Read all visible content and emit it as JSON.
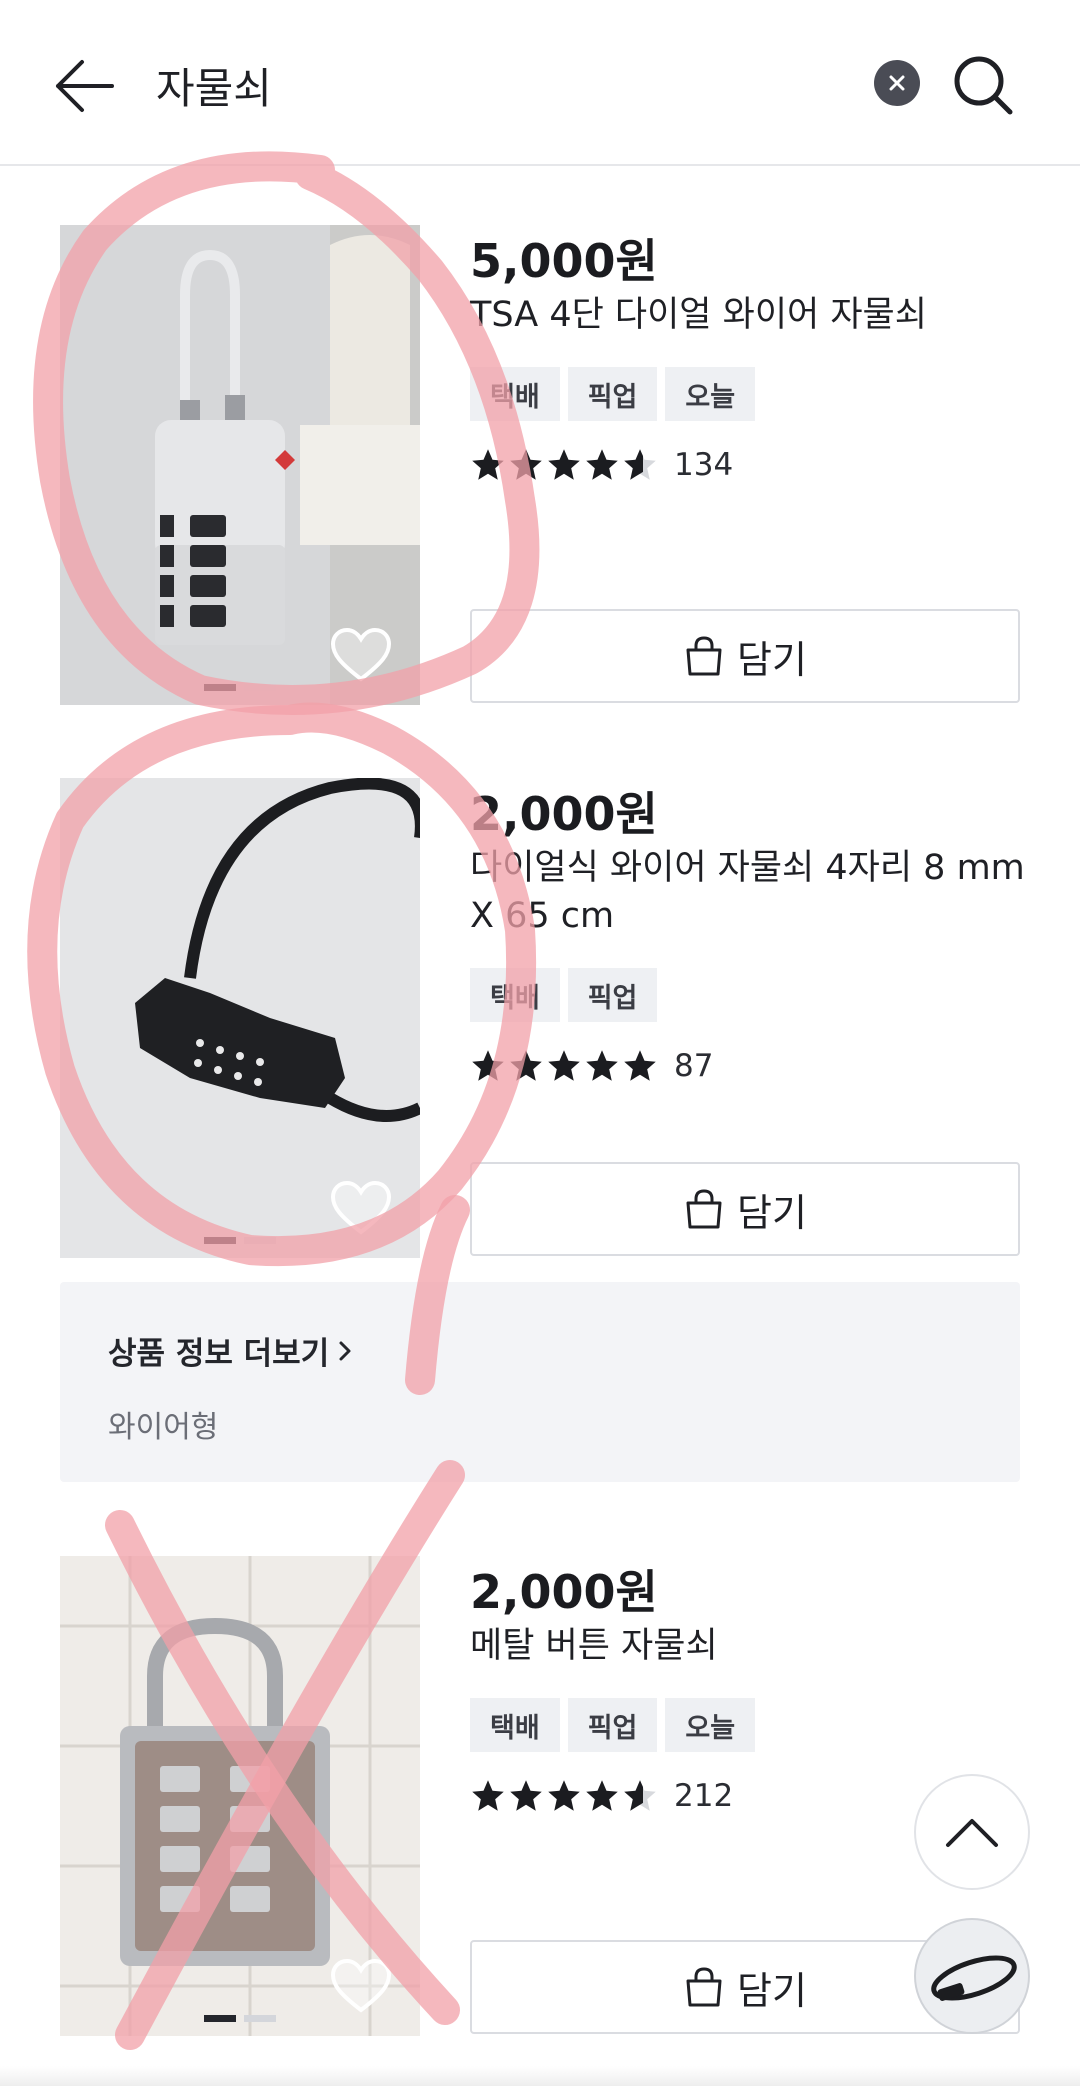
{
  "header": {
    "search_query": "자물쇠",
    "back_icon": "arrow-left-icon",
    "clear_icon": "close-icon",
    "search_icon": "search-icon"
  },
  "products": [
    {
      "price": "5,000원",
      "title": "TSA 4단 다이얼 와이어 자물쇠",
      "tags": [
        "택배",
        "픽업",
        "오늘"
      ],
      "rating": 4.5,
      "review_count": "134",
      "cart_label": "담기",
      "image_pages": 2,
      "image_page_active": 1
    },
    {
      "price": "2,000원",
      "title": "다이얼식 와이어 자물쇠 4자리 8 mm X 65 cm",
      "tags": [
        "택배",
        "픽업"
      ],
      "rating": 5,
      "review_count": "87",
      "cart_label": "담기",
      "image_pages": 2,
      "image_page_active": 1
    },
    {
      "price": "2,000원",
      "title": "메탈 버튼 자물쇠",
      "tags": [
        "택배",
        "픽업",
        "오늘"
      ],
      "rating": 4.5,
      "review_count": "212",
      "cart_label": "담기",
      "image_pages": 2,
      "image_page_active": 1
    }
  ],
  "info_panel": {
    "title": "상품 정보 더보기",
    "description": "와이어형"
  },
  "floating": {
    "scroll_top_icon": "chevron-up-icon",
    "recent_item_icon": "cable-lock-thumbnail"
  },
  "colors": {
    "accent_text": "#1b1c20",
    "tag_bg": "#eef0f3",
    "annotation": "#f2a0a8"
  }
}
